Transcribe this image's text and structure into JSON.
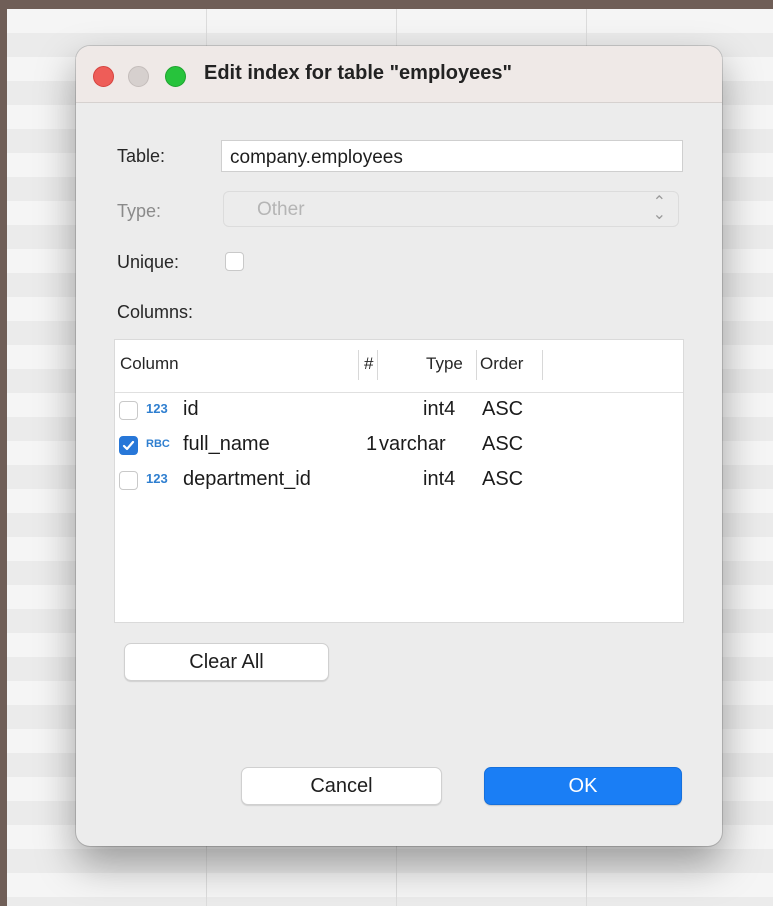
{
  "window": {
    "title": "Edit index for table \"employees\""
  },
  "form": {
    "table_label": "Table:",
    "table_value": "company.employees",
    "type_label": "Type:",
    "type_value": "Other",
    "unique_label": "Unique:",
    "unique_checked": false,
    "columns_label": "Columns:"
  },
  "columns_table": {
    "headers": {
      "column": "Column",
      "number": "#",
      "type": "Type",
      "order": "Order"
    },
    "rows": [
      {
        "checked": false,
        "type_icon": "123",
        "name": "id",
        "number": "",
        "type": "int4",
        "order": "ASC"
      },
      {
        "checked": true,
        "type_icon": "RBC",
        "name": "full_name",
        "number": "1",
        "type": "varchar",
        "order": "ASC"
      },
      {
        "checked": false,
        "type_icon": "123",
        "name": "department_id",
        "number": "",
        "type": "int4",
        "order": "ASC"
      }
    ]
  },
  "buttons": {
    "clear_all": "Clear All",
    "cancel": "Cancel",
    "ok": "OK"
  },
  "colors": {
    "accent": "#1a7ef5",
    "close": "#ee5d58",
    "zoom": "#27c33c"
  }
}
